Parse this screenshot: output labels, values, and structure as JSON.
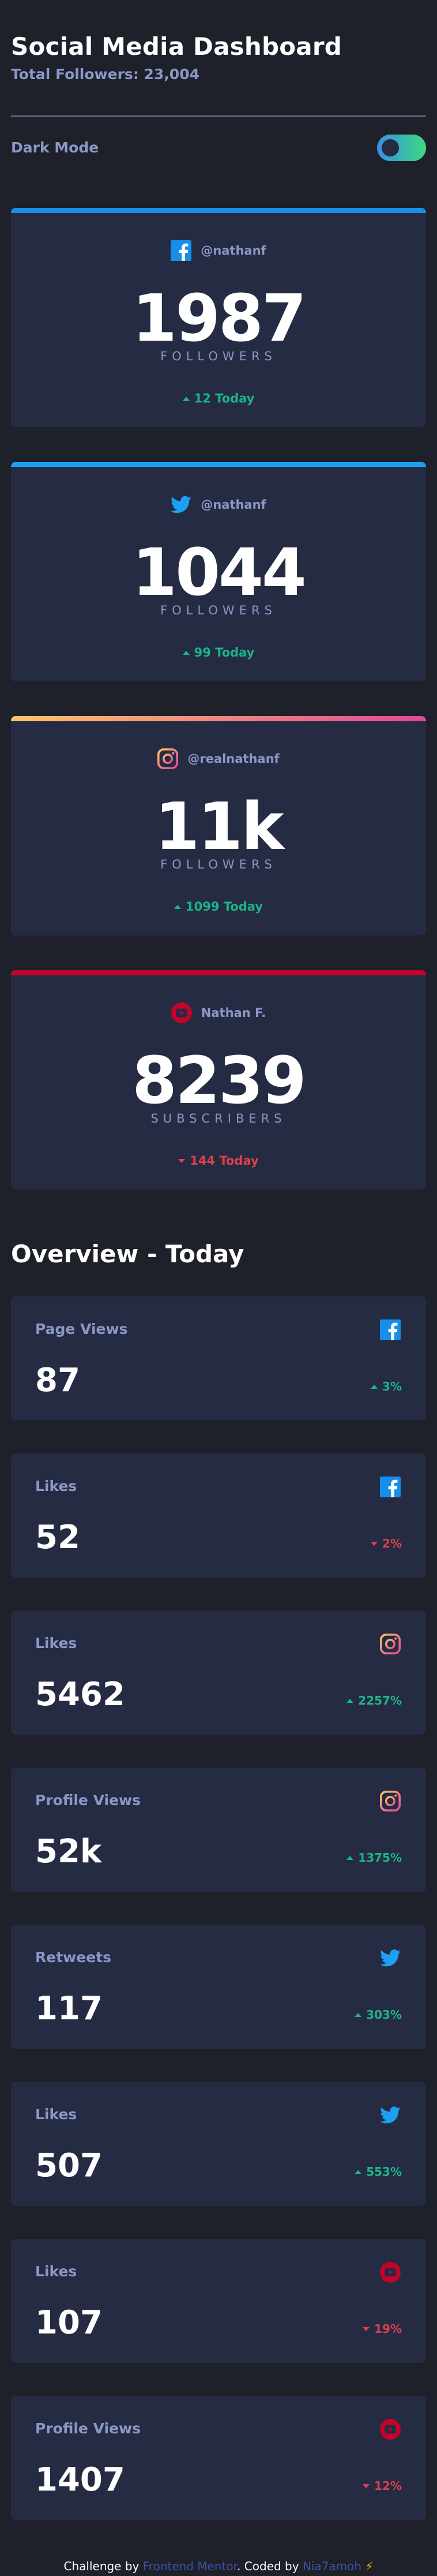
{
  "header": {
    "title": "Social Media Dashboard",
    "total_followers": "Total Followers: 23,004",
    "dark_mode_label": "Dark Mode"
  },
  "colors": {
    "facebook": "#178fe8",
    "twitter": "#1ca0f2",
    "instagram_start": "#fdc468",
    "instagram_end": "#df4996",
    "youtube": "#c4032b",
    "up": "#1db489",
    "down": "#dc414c"
  },
  "social_cards": [
    {
      "platform": "facebook",
      "icon": "facebook-icon",
      "handle": "@nathanf",
      "count": "1987",
      "count_label": "FOLLOWERS",
      "today": "12 Today",
      "trend": "up"
    },
    {
      "platform": "twitter",
      "icon": "twitter-icon",
      "handle": "@nathanf",
      "count": "1044",
      "count_label": "FOLLOWERS",
      "today": "99 Today",
      "trend": "up"
    },
    {
      "platform": "instagram",
      "icon": "instagram-icon",
      "handle": "@realnathanf",
      "count": "11k",
      "count_label": "FOLLOWERS",
      "today": "1099 Today",
      "trend": "up"
    },
    {
      "platform": "youtube",
      "icon": "youtube-icon",
      "handle": "Nathan F.",
      "count": "8239",
      "count_label": "SUBSCRIBERS",
      "today": "144 Today",
      "trend": "down"
    }
  ],
  "overview": {
    "title": "Overview - Today",
    "items": [
      {
        "label": "Page Views",
        "platform": "facebook",
        "icon": "facebook-icon",
        "value": "87",
        "change": "3%",
        "trend": "up"
      },
      {
        "label": "Likes",
        "platform": "facebook",
        "icon": "facebook-icon",
        "value": "52",
        "change": "2%",
        "trend": "down"
      },
      {
        "label": "Likes",
        "platform": "instagram",
        "icon": "instagram-icon",
        "value": "5462",
        "change": "2257%",
        "trend": "up"
      },
      {
        "label": "Profile Views",
        "platform": "instagram",
        "icon": "instagram-icon",
        "value": "52k",
        "change": "1375%",
        "trend": "up"
      },
      {
        "label": "Retweets",
        "platform": "twitter",
        "icon": "twitter-icon",
        "value": "117",
        "change": "303%",
        "trend": "up"
      },
      {
        "label": "Likes",
        "platform": "twitter",
        "icon": "twitter-icon",
        "value": "507",
        "change": "553%",
        "trend": "up"
      },
      {
        "label": "Likes",
        "platform": "youtube",
        "icon": "youtube-icon",
        "value": "107",
        "change": "19%",
        "trend": "down"
      },
      {
        "label": "Profile Views",
        "platform": "youtube",
        "icon": "youtube-icon",
        "value": "1407",
        "change": "12%",
        "trend": "down"
      }
    ]
  },
  "footer": {
    "prefix": "Challenge by ",
    "link1": "Frontend Mentor",
    "middle": ". Coded by ",
    "link2": "Nia7amoh",
    "bolt": "⚡"
  }
}
